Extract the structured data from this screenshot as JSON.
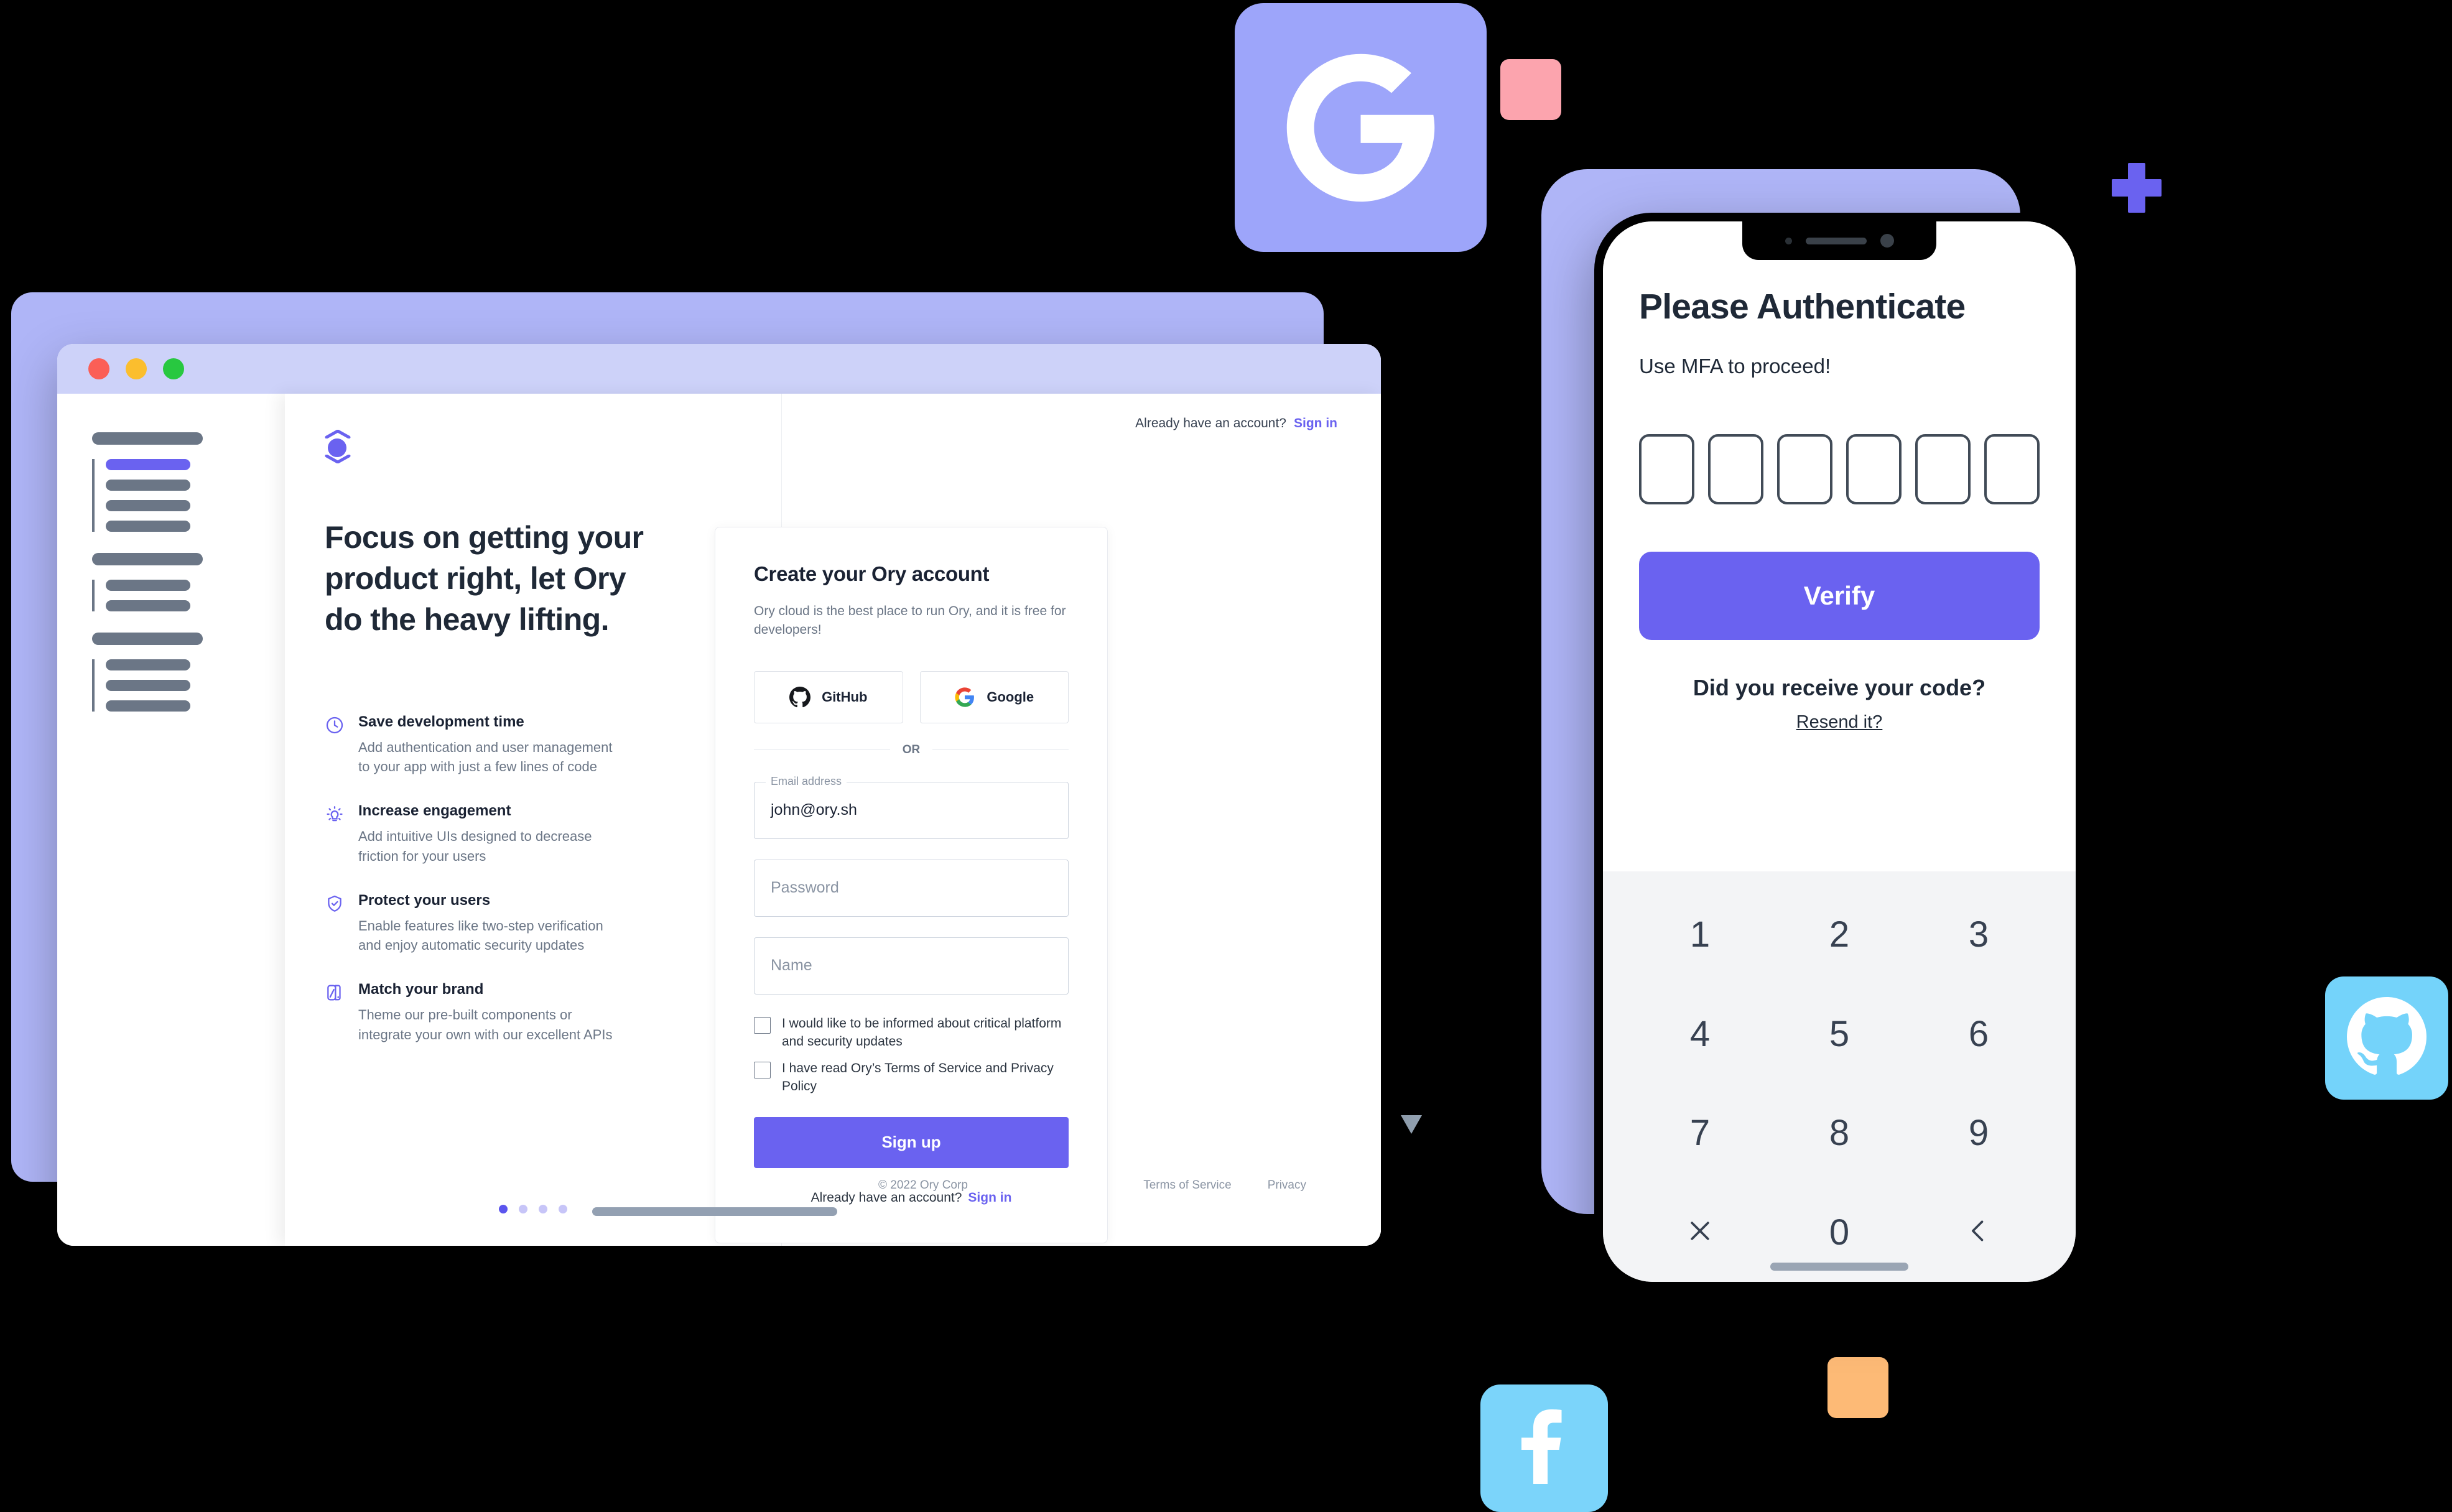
{
  "theme": {
    "accent": "#6A62F0",
    "accent_light": "#9DA5FA",
    "pink": "#FCA4AE",
    "orange": "#FDBA76",
    "sky": "#74D3FA",
    "text_dark": "#1A2233",
    "text_muted": "#6B7686"
  },
  "decorations": {
    "google_tile_icon": "google-g-icon",
    "github_tile_icon": "github-icon",
    "facebook_tile_icon": "facebook-icon",
    "plus_icon": "plus-shape",
    "triangle_icon": "triangle-down-shape",
    "pink_square": "pink-square-shape",
    "orange_square": "orange-square-shape"
  },
  "browser": {
    "traffic_lights": [
      "close-red",
      "minimize-yellow",
      "maximize-green"
    ],
    "sidebar_skeleton": {
      "groups": [
        {
          "header": true,
          "lines": 4,
          "active_index": 0
        },
        {
          "header": true,
          "lines": 2,
          "active_index": -1
        },
        {
          "header": true,
          "lines": 3,
          "active_index": -1
        }
      ]
    }
  },
  "left_pane": {
    "logo": "ory-logo",
    "hero_lines": [
      "Focus on getting your",
      "product right, let Ory",
      "do the heavy lifting."
    ],
    "features": [
      {
        "icon": "clock-icon",
        "title": "Save development time",
        "desc": "Add authentication and user management to your app with just a few lines of code"
      },
      {
        "icon": "lightbulb-icon",
        "title": "Increase engagement",
        "desc": "Add intuitive UIs designed to decrease friction for your users"
      },
      {
        "icon": "shield-check-icon",
        "title": "Protect your users",
        "desc": "Enable features like two-step verification and enjoy automatic security updates"
      },
      {
        "icon": "palette-icon",
        "title": "Match your brand",
        "desc": "Theme our pre-built components or integrate your own with our excellent APIs"
      }
    ],
    "carousel": {
      "count": 4,
      "active": 0
    }
  },
  "signup": {
    "top_prompt": "Already have an account?",
    "top_link": "Sign in",
    "title": "Create your Ory account",
    "subtitle": "Ory cloud is the best place to run Ory, and it is free for developers!",
    "oauth": [
      {
        "label": "GitHub",
        "icon": "github-icon"
      },
      {
        "label": "Google",
        "icon": "google-color-icon"
      }
    ],
    "divider": "OR",
    "fields": [
      {
        "label": "Email address",
        "value": "john@ory.sh",
        "placeholder": ""
      },
      {
        "label": "",
        "value": "",
        "placeholder": "Password"
      },
      {
        "label": "",
        "value": "",
        "placeholder": "Name"
      }
    ],
    "checkboxes": [
      {
        "label": "I would like to be informed about critical platform and security updates",
        "checked": false
      },
      {
        "label": "I have read Ory’s Terms of Service and Privacy Policy",
        "checked": false
      }
    ],
    "submit_label": "Sign up",
    "bottom_prompt": "Already have an account?",
    "bottom_link": "Sign in"
  },
  "footer": {
    "copyright": "© 2022 Ory Corp",
    "links": [
      "Terms of Service",
      "Privacy"
    ]
  },
  "phone": {
    "title": "Please Authenticate",
    "subtitle": "Use MFA to proceed!",
    "otp_boxes": 6,
    "otp_values": [
      "",
      "",
      "",
      "",
      "",
      ""
    ],
    "verify_label": "Verify",
    "code_prompt": "Did you receive your code?",
    "resend_label": "Resend it?",
    "keypad": [
      {
        "label": "1",
        "icon": ""
      },
      {
        "label": "2",
        "icon": ""
      },
      {
        "label": "3",
        "icon": ""
      },
      {
        "label": "4",
        "icon": ""
      },
      {
        "label": "5",
        "icon": ""
      },
      {
        "label": "6",
        "icon": ""
      },
      {
        "label": "7",
        "icon": ""
      },
      {
        "label": "8",
        "icon": ""
      },
      {
        "label": "9",
        "icon": ""
      },
      {
        "label": "",
        "icon": "close-x-icon"
      },
      {
        "label": "0",
        "icon": ""
      },
      {
        "label": "",
        "icon": "backspace-chevron-icon"
      }
    ]
  }
}
